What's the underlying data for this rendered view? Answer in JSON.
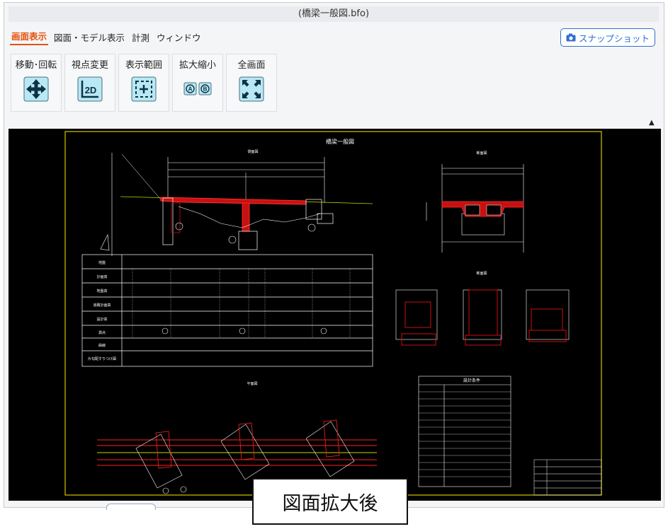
{
  "window": {
    "title": "(橋梁一般図.bfo)"
  },
  "menu": [
    {
      "label": "画面表示",
      "active": true
    },
    {
      "label": "図面・モデル表示",
      "active": false
    },
    {
      "label": "計測",
      "active": false
    },
    {
      "label": "ウィンドウ",
      "active": false
    }
  ],
  "snapshot_button": {
    "label": "スナップショット",
    "icon": "camera-icon"
  },
  "tools": [
    {
      "label": "移動･回転",
      "icon": "move-rotate-icon"
    },
    {
      "label": "視点変更",
      "icon": "view-2d-icon",
      "icon_text": "2D"
    },
    {
      "label": "表示範囲",
      "icon": "fit-range-icon"
    },
    {
      "label": "拡大縮小",
      "icon": "zoom-icon",
      "icon_text_a": "A",
      "icon_text_b": "B"
    },
    {
      "label": "全画面",
      "icon": "fullscreen-icon"
    }
  ],
  "drawing": {
    "title": "橋梁一般図",
    "views": {
      "side": "側面図",
      "cross": "断面図",
      "pier": "断面図",
      "plan": "平面図",
      "design_table": "設計条件"
    },
    "row_labels": [
      "地盤",
      "計画高",
      "地盤高",
      "道路計画高",
      "設計高",
      "測点",
      "曲線",
      "片勾配すりつけ図"
    ]
  },
  "caption": "図面拡大後",
  "colors": {
    "accent": "#e4520b",
    "link_blue": "#2f6fd0",
    "canvas": "#000000",
    "frame": "#d6c400"
  }
}
